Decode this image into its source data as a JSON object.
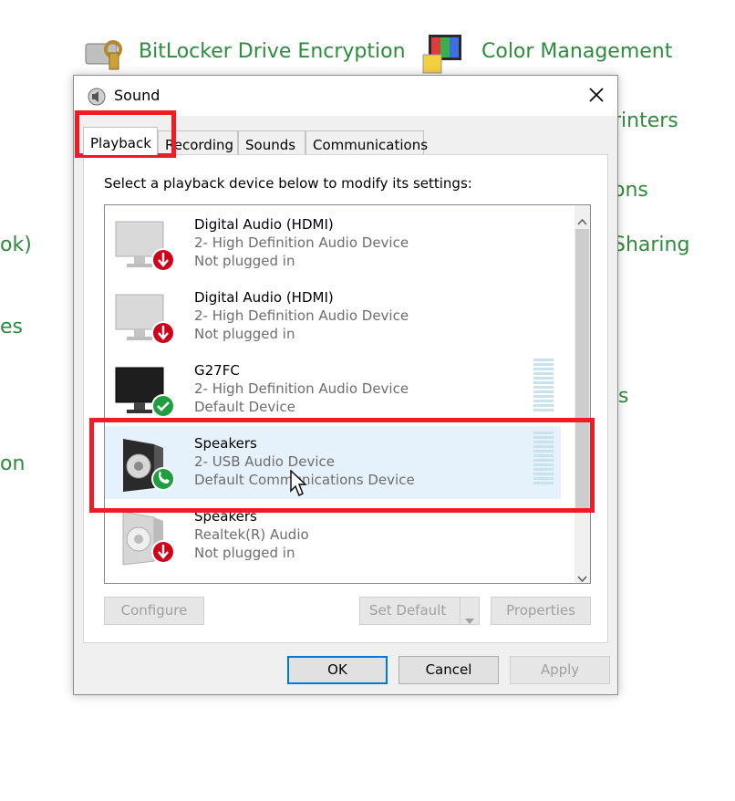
{
  "background": {
    "links": [
      {
        "label": "BitLocker Drive Encryption"
      },
      {
        "label": "Color Management"
      },
      {
        "label": "rinters"
      },
      {
        "label": "ons"
      },
      {
        "label": "Sharing"
      },
      {
        "label": "ok)"
      },
      {
        "label": "es"
      },
      {
        "label": "s"
      },
      {
        "label": "on"
      }
    ],
    "link_color": "#2f8a3e"
  },
  "dialog": {
    "title": "Sound",
    "title_icon": "speaker-icon",
    "close_icon": "close-icon",
    "tabs": [
      {
        "label": "Playback",
        "active": true
      },
      {
        "label": "Recording",
        "active": false
      },
      {
        "label": "Sounds",
        "active": false
      },
      {
        "label": "Communications",
        "active": false
      }
    ],
    "instruction": "Select a playback device below to modify its settings:",
    "devices": [
      {
        "name": "Digital Audio (HDMI)",
        "description": "2- High Definition Audio Device",
        "status": "Not plugged in",
        "icon": "monitor-icon",
        "badge": "unplugged-badge-icon",
        "selected": false
      },
      {
        "name": "Digital Audio (HDMI)",
        "description": "2- High Definition Audio Device",
        "status": "Not plugged in",
        "icon": "monitor-icon",
        "badge": "unplugged-badge-icon",
        "selected": false
      },
      {
        "name": "G27FC",
        "description": "2- High Definition Audio Device",
        "status": "Default Device",
        "icon": "monitor-icon",
        "badge": "default-check-badge-icon",
        "selected": false
      },
      {
        "name": "Speakers",
        "description": "2- USB Audio Device",
        "status": "Default Communications Device",
        "icon": "speaker-box-icon",
        "badge": "phone-badge-icon",
        "selected": true
      },
      {
        "name": "Speakers",
        "description": "Realtek(R) Audio",
        "status": "Not plugged in",
        "icon": "speaker-box-icon",
        "badge": "unplugged-badge-icon",
        "selected": false
      }
    ],
    "buttons": {
      "configure": "Configure",
      "set_default": "Set Default",
      "properties": "Properties",
      "ok": "OK",
      "cancel": "Cancel",
      "apply": "Apply"
    },
    "colors": {
      "highlight": "#ee1c25",
      "selection": "#e5f1fb",
      "ok_badge": "#1e9e3e",
      "unplugged_badge": "#d0021b"
    }
  }
}
